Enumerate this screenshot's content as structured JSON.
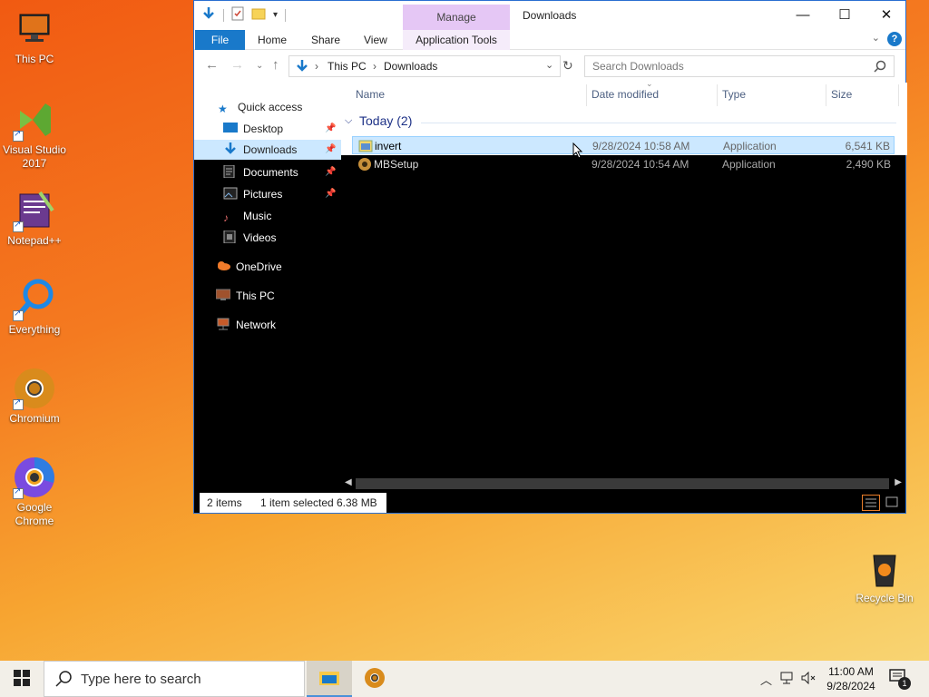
{
  "desktop": {
    "icons": [
      {
        "label": "This PC"
      },
      {
        "label": "Visual Studio 2017"
      },
      {
        "label": "Notepad++"
      },
      {
        "label": "Everything"
      },
      {
        "label": "Chromium"
      },
      {
        "label": "Google Chrome"
      },
      {
        "label": "Recycle Bin"
      }
    ]
  },
  "window": {
    "title": "Downloads",
    "manage_tab": "Manage",
    "ribbon_tabs": [
      "File",
      "Home",
      "Share",
      "View",
      "Application Tools"
    ],
    "address": {
      "crumbs": [
        "This PC",
        "Downloads"
      ]
    },
    "search_placeholder": "Search Downloads",
    "nav": {
      "quick_access": "Quick access",
      "items": [
        "Desktop",
        "Downloads",
        "Documents",
        "Pictures",
        "Music",
        "Videos"
      ],
      "onedrive": "OneDrive",
      "thispc": "This PC",
      "network": "Network"
    },
    "columns": [
      "Name",
      "Date modified",
      "Type",
      "Size"
    ],
    "group": "Today (2)",
    "files": [
      {
        "name": "invert",
        "date": "9/28/2024 10:58 AM",
        "type": "Application",
        "size": "6,541 KB",
        "selected": true
      },
      {
        "name": "MBSetup",
        "date": "9/28/2024 10:54 AM",
        "type": "Application",
        "size": "2,490 KB",
        "selected": false
      }
    ],
    "status": {
      "count": "2 items",
      "selection": "1 item selected",
      "size": "6.38 MB"
    }
  },
  "taskbar": {
    "search_placeholder": "Type here to search",
    "time": "11:00 AM",
    "date": "9/28/2024",
    "notification_count": "1"
  },
  "colors": {
    "accent": "#1979ca",
    "selection": "#cce8ff",
    "manage": "#e5c7f5"
  }
}
